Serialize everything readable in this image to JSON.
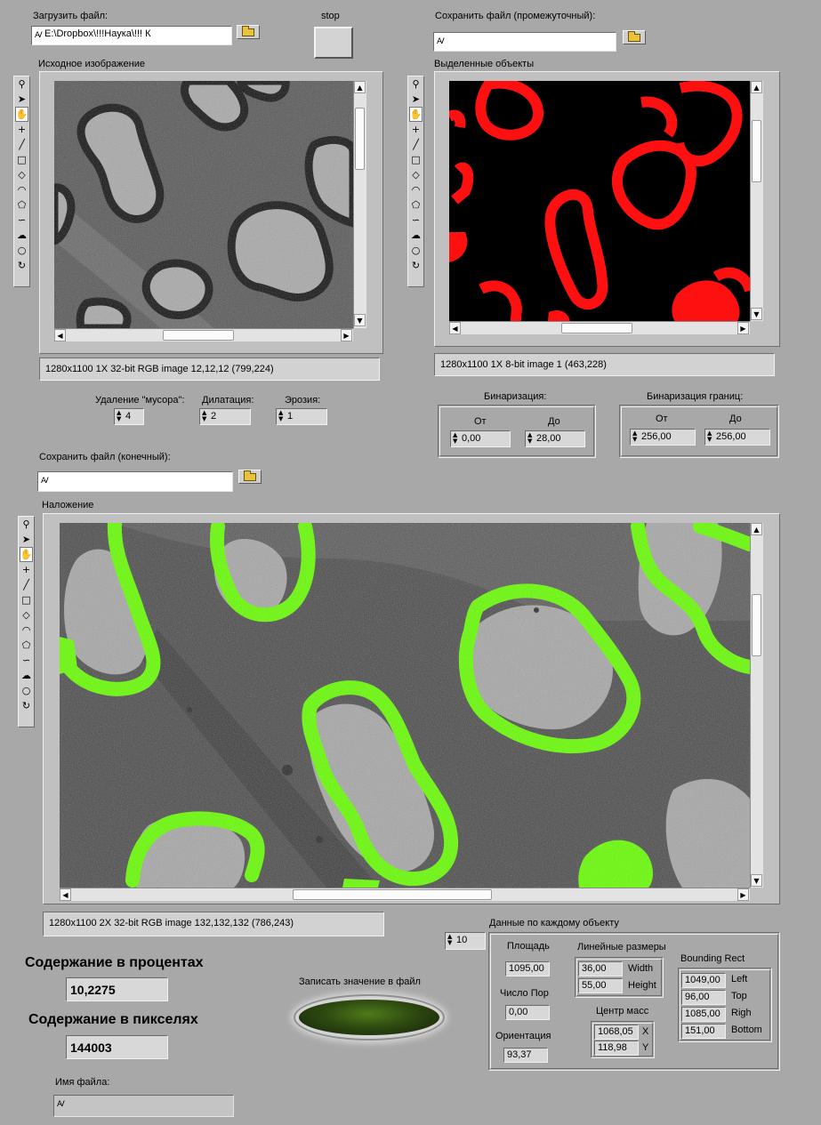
{
  "load_file": {
    "label": "Загрузить файл:",
    "path": "E:\\Dropbox\\!!!Наука\\!!! К"
  },
  "stop": {
    "label": "stop"
  },
  "save_intermediate": {
    "label": "Сохранить файл (промежуточный):",
    "path": ""
  },
  "save_final": {
    "label": "Сохранить файл (конечный):",
    "path": ""
  },
  "source_image": {
    "title": "Исходное изображение",
    "info": "1280x1100 1X 32-bit RGB image 12,12,12    (799,224)"
  },
  "objects_image": {
    "title": "Выделенные объекты",
    "info": "1280x1100 1X 8-bit image 1    (463,228)"
  },
  "overlay_image": {
    "title": "Наложение",
    "info": "1280x1100 2X 32-bit RGB image 132,132,132    (786,243)"
  },
  "tools": [
    "zoom-icon",
    "pointer-icon",
    "pan-icon",
    "crosshair-icon",
    "line-tool-icon",
    "rectangle-tool-icon",
    "rotated-rect-icon",
    "annulus-icon",
    "polygon-icon",
    "freehand-icon",
    "freehand-region-icon",
    "oval-icon",
    "rotation-icon"
  ],
  "params": {
    "debris": {
      "label": "Удаление \"мусора\":",
      "value": "4"
    },
    "dilation": {
      "label": "Дилатация:",
      "value": "2"
    },
    "erosion": {
      "label": "Эрозия:",
      "value": "1"
    }
  },
  "binarization": {
    "title": "Бинаризация:",
    "from_label": "От",
    "to_label": "До",
    "from": "0,00",
    "to": "28,00"
  },
  "edge_binarization": {
    "title": "Бинаризация границ:",
    "from_label": "От",
    "to_label": "До",
    "from": "256,00",
    "to": "256,00"
  },
  "content_percent": {
    "label": "Содержание в процентах",
    "value": "10,2275"
  },
  "content_pixels": {
    "label": "Содержание в пикселях",
    "value": "144003"
  },
  "write_button": {
    "label": "Записать значение в файл"
  },
  "file_name": {
    "label": "Имя файла:",
    "value": ""
  },
  "object_data": {
    "title": "Данные по каждому объекту",
    "index": "10",
    "area": {
      "label": "Площадь",
      "value": "1095,00"
    },
    "pores": {
      "label": "Число Пор",
      "value": "0,00"
    },
    "orientation": {
      "label": "Ориентация",
      "value": "93,37"
    },
    "linear": {
      "label": "Линейные размеры",
      "width_label": "Width",
      "height_label": "Height",
      "width": "36,00",
      "height": "55,00"
    },
    "center": {
      "label": "Центр масс",
      "x_label": "X",
      "y_label": "Y",
      "x": "1068,05",
      "y": "118,98"
    },
    "bounding": {
      "label": "Bounding Rect",
      "left_label": "Left",
      "top_label": "Top",
      "right_label": "Righ",
      "bottom_label": "Bottom",
      "left": "1049,00",
      "top": "96,00",
      "right": "1085,00",
      "bottom": "151,00"
    }
  }
}
